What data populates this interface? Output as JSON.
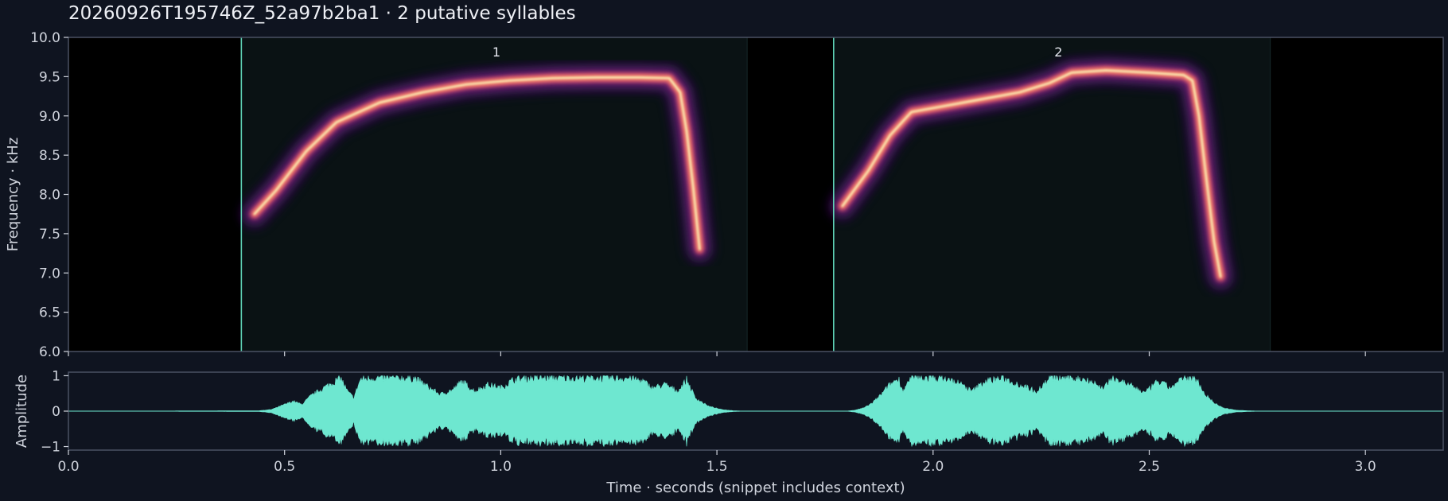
{
  "chart_data": {
    "title": "20260926T195746Z_52a97b2ba1  ·  2 putative syllables",
    "x_label": "Time · seconds (snippet includes context)",
    "x_range": [
      0.0,
      3.18
    ],
    "x_ticks": [
      {
        "value": 0.0,
        "label": "0.0"
      },
      {
        "value": 0.5,
        "label": "0.5"
      },
      {
        "value": 1.0,
        "label": "1.0"
      },
      {
        "value": 1.5,
        "label": "1.5"
      },
      {
        "value": 2.0,
        "label": "2.0"
      },
      {
        "value": 2.5,
        "label": "2.5"
      },
      {
        "value": 3.0,
        "label": "3.0"
      }
    ],
    "spectrogram": {
      "type": "heatmap",
      "y_label": "Frequency · kHz",
      "y_range": [
        6.0,
        10.0
      ],
      "y_ticks": [
        {
          "value": 6.0,
          "label": "6.0"
        },
        {
          "value": 6.5,
          "label": "6.5"
        },
        {
          "value": 7.0,
          "label": "7.0"
        },
        {
          "value": 7.5,
          "label": "7.5"
        },
        {
          "value": 8.0,
          "label": "8.0"
        },
        {
          "value": 8.5,
          "label": "8.5"
        },
        {
          "value": 9.0,
          "label": "9.0"
        },
        {
          "value": 9.5,
          "label": "9.5"
        },
        {
          "value": 10.0,
          "label": "10.0"
        }
      ],
      "colormap": [
        "#000004",
        "#3b0f70",
        "#8c2981",
        "#de4968",
        "#fe9f6d",
        "#fcfdbf"
      ],
      "syllables": [
        {
          "label": "1",
          "start": 0.4,
          "end": 1.57,
          "label_time": 0.99,
          "contour": [
            [
              0.43,
              7.75
            ],
            [
              0.48,
              8.05
            ],
            [
              0.55,
              8.55
            ],
            [
              0.62,
              8.92
            ],
            [
              0.72,
              9.17
            ],
            [
              0.82,
              9.3
            ],
            [
              0.92,
              9.4
            ],
            [
              1.02,
              9.45
            ],
            [
              1.12,
              9.48
            ],
            [
              1.22,
              9.49
            ],
            [
              1.32,
              9.49
            ],
            [
              1.39,
              9.48
            ],
            [
              1.415,
              9.3
            ],
            [
              1.43,
              8.8
            ],
            [
              1.445,
              8.1
            ],
            [
              1.46,
              7.3
            ]
          ]
        },
        {
          "label": "2",
          "start": 1.77,
          "end": 2.78,
          "label_time": 2.29,
          "contour": [
            [
              1.79,
              7.85
            ],
            [
              1.85,
              8.3
            ],
            [
              1.9,
              8.75
            ],
            [
              1.95,
              9.05
            ],
            [
              2.02,
              9.12
            ],
            [
              2.1,
              9.2
            ],
            [
              2.2,
              9.3
            ],
            [
              2.27,
              9.42
            ],
            [
              2.32,
              9.55
            ],
            [
              2.4,
              9.58
            ],
            [
              2.5,
              9.55
            ],
            [
              2.58,
              9.52
            ],
            [
              2.6,
              9.45
            ],
            [
              2.615,
              9.0
            ],
            [
              2.63,
              8.3
            ],
            [
              2.65,
              7.4
            ],
            [
              2.665,
              6.95
            ]
          ]
        }
      ]
    },
    "waveform": {
      "type": "area",
      "y_label": "Amplitude",
      "y_range": [
        -1.1,
        1.1
      ],
      "y_ticks": [
        {
          "value": 1,
          "label": "1"
        },
        {
          "value": 0,
          "label": "0"
        },
        {
          "value": -1,
          "label": "−1"
        }
      ],
      "color": "#6ee7d0",
      "envelope": [
        [
          0.0,
          0.0
        ],
        [
          0.44,
          0.01
        ],
        [
          0.47,
          0.05
        ],
        [
          0.5,
          0.2
        ],
        [
          0.52,
          0.3
        ],
        [
          0.54,
          0.2
        ],
        [
          0.56,
          0.45
        ],
        [
          0.59,
          0.7
        ],
        [
          0.61,
          0.85
        ],
        [
          0.63,
          1.0
        ],
        [
          0.645,
          0.6
        ],
        [
          0.66,
          0.4
        ],
        [
          0.675,
          0.95
        ],
        [
          0.7,
          1.0
        ],
        [
          0.75,
          1.0
        ],
        [
          0.8,
          1.0
        ],
        [
          0.83,
          0.75
        ],
        [
          0.86,
          0.5
        ],
        [
          0.89,
          0.65
        ],
        [
          0.91,
          0.9
        ],
        [
          0.94,
          0.6
        ],
        [
          0.97,
          0.8
        ],
        [
          1.0,
          0.7
        ],
        [
          1.03,
          0.95
        ],
        [
          1.06,
          1.0
        ],
        [
          1.1,
          1.0
        ],
        [
          1.15,
          1.0
        ],
        [
          1.2,
          1.0
        ],
        [
          1.25,
          1.0
        ],
        [
          1.3,
          1.0
        ],
        [
          1.33,
          0.9
        ],
        [
          1.35,
          0.7
        ],
        [
          1.38,
          0.8
        ],
        [
          1.41,
          0.6
        ],
        [
          1.43,
          0.95
        ],
        [
          1.45,
          0.4
        ],
        [
          1.48,
          0.15
        ],
        [
          1.51,
          0.05
        ],
        [
          1.54,
          0.01
        ],
        [
          1.57,
          0.0
        ],
        [
          1.8,
          0.0
        ],
        [
          1.82,
          0.03
        ],
        [
          1.84,
          0.1
        ],
        [
          1.86,
          0.25
        ],
        [
          1.88,
          0.5
        ],
        [
          1.9,
          0.8
        ],
        [
          1.92,
          1.0
        ],
        [
          1.93,
          0.6
        ],
        [
          1.95,
          1.0
        ],
        [
          1.98,
          1.0
        ],
        [
          2.02,
          1.0
        ],
        [
          2.06,
          0.85
        ],
        [
          2.09,
          0.6
        ],
        [
          2.12,
          0.9
        ],
        [
          2.16,
          1.0
        ],
        [
          2.2,
          0.8
        ],
        [
          2.24,
          0.6
        ],
        [
          2.27,
          1.0
        ],
        [
          2.32,
          1.0
        ],
        [
          2.36,
          0.95
        ],
        [
          2.39,
          0.7
        ],
        [
          2.42,
          1.0
        ],
        [
          2.46,
          0.75
        ],
        [
          2.49,
          0.55
        ],
        [
          2.52,
          0.9
        ],
        [
          2.55,
          0.7
        ],
        [
          2.58,
          1.0
        ],
        [
          2.61,
          0.95
        ],
        [
          2.63,
          0.5
        ],
        [
          2.65,
          0.25
        ],
        [
          2.67,
          0.1
        ],
        [
          2.7,
          0.03
        ],
        [
          2.73,
          0.01
        ],
        [
          2.76,
          0.0
        ],
        [
          3.18,
          0.0
        ]
      ]
    }
  }
}
